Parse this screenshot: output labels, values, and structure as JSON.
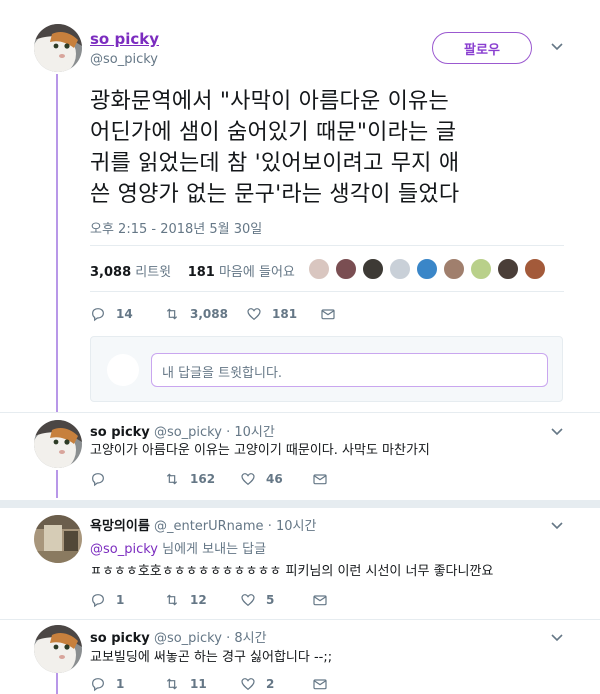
{
  "main_tweet": {
    "display_name": "so picky",
    "handle": "@so_picky",
    "follow_label": "팔로우",
    "text_lines": [
      "광화문역에서 \"사막이 아름다운 이유는",
      "어딘가에 샘이 숨어있기 때문\"이라는 글",
      "귀를 읽었는데 참 '있어보이려고 무지 애",
      "쓴 영양가 없는 문구'라는 생각이 들었다"
    ],
    "timestamp": "오후 2:15 - 2018년 5월 30일",
    "retweets_count": "3,088",
    "retweets_label": "리트윗",
    "likes_count": "181",
    "likes_label": "마음에 들어요",
    "actions": {
      "reply": "14",
      "retweet": "3,088",
      "like": "181"
    },
    "liker_colors": [
      "#d9c6c0",
      "#7a4e52",
      "#3d3a35",
      "#c9d0d8",
      "#3a86c8",
      "#a07f6d",
      "#b9d08a",
      "#4a3e38",
      "#a35a3a"
    ]
  },
  "reply_box": {
    "placeholder": "내 답글을 트윗합니다."
  },
  "replies": [
    {
      "display_name": "so picky",
      "handle": "@so_picky",
      "time": "· 10시간",
      "mention_prefix": "",
      "mention_link": "",
      "mention_suffix": "",
      "text": "고양이가 아름다운 이유는 고양이기 때문이다. 사막도 마찬가지",
      "actions": {
        "reply": "",
        "retweet": "162",
        "like": "46"
      }
    },
    {
      "display_name": "욕망의이름",
      "handle": "@_enterURname",
      "time": "· 10시간",
      "mention_link": "@so_picky",
      "mention_suffix": " 님에게 보내는 답글",
      "text": "ㅍㅎㅎㅎ호호ㅎㅎㅎㅎㅎㅎㅎㅎㅎㅎ 피키님의 이런 시선이 너무 좋다니깐요",
      "actions": {
        "reply": "1",
        "retweet": "12",
        "like": "5"
      }
    },
    {
      "display_name": "so picky",
      "handle": "@so_picky",
      "time": "· 8시간",
      "text": "교보빌딩에 써놓곤 하는 경구 싫어합니다 --;;",
      "actions": {
        "reply": "1",
        "retweet": "11",
        "like": "2"
      }
    }
  ],
  "colors": {
    "accent": "#7b2cbf",
    "thread": "#b897e8",
    "muted": "#657786"
  }
}
